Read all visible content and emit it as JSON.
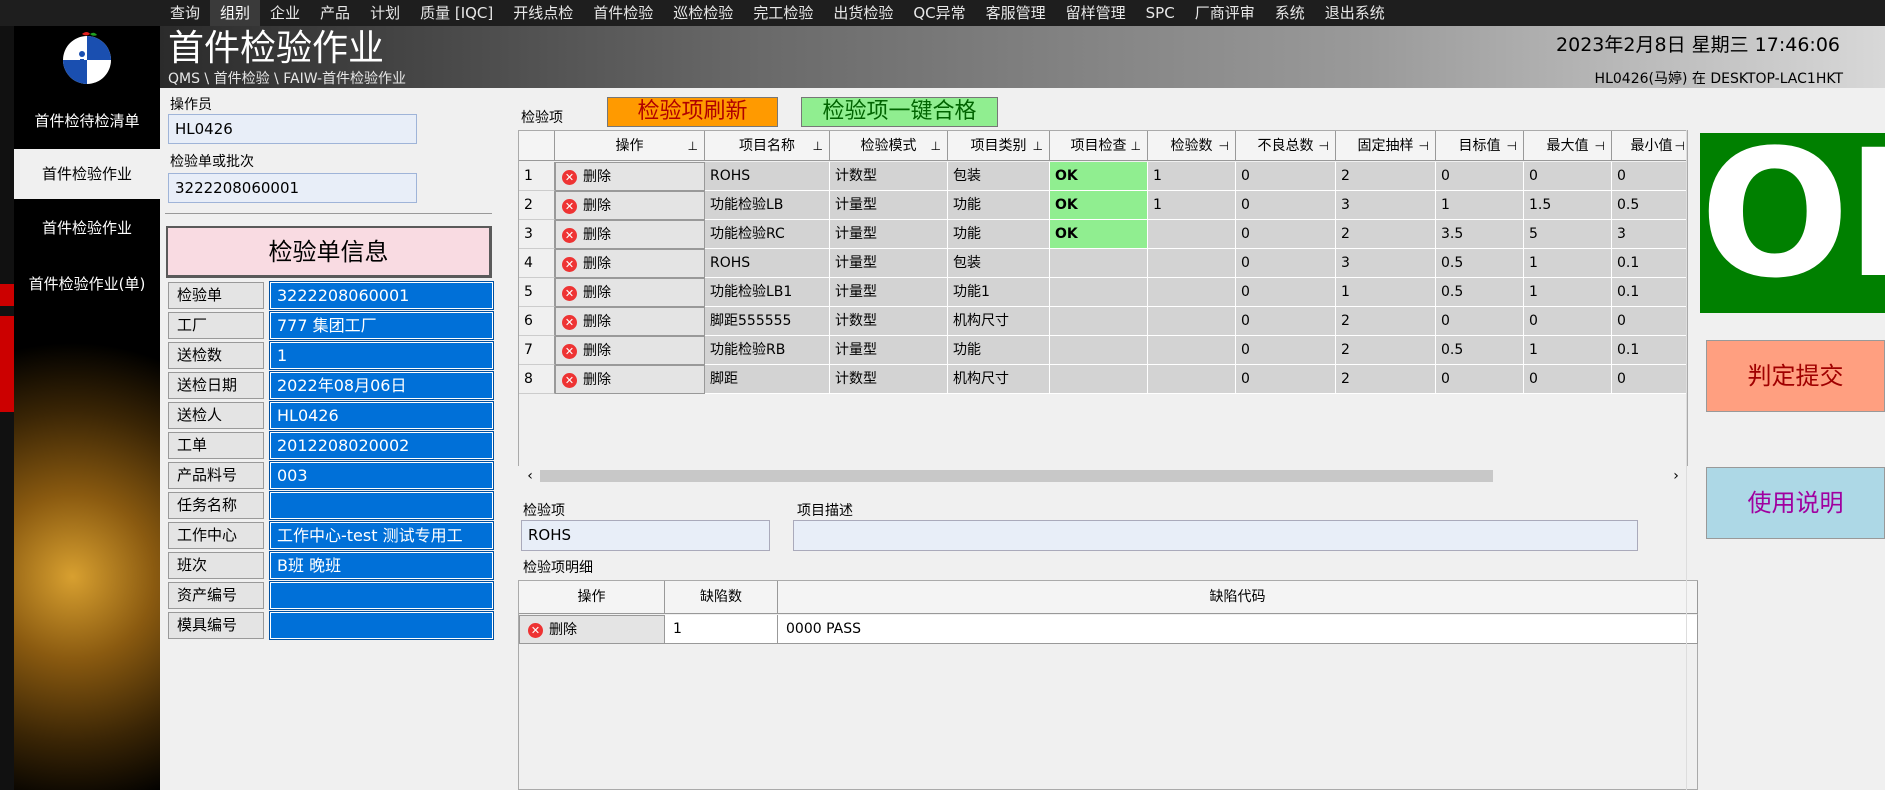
{
  "menu": {
    "hidden_item": "",
    "items": [
      "查询",
      "组别",
      "企业",
      "产品",
      "计划",
      "质量 [IQC]",
      "开线点检",
      "首件检验",
      "巡检检验",
      "完工检验",
      "出货检验",
      "QC异常",
      "客服管理",
      "留样管理",
      "SPC",
      "厂商评审",
      "系统",
      "退出系统"
    ],
    "active_index": 1
  },
  "header": {
    "title": "首件检验作业",
    "breadcrumb": "QMS \\ 首件检验 \\ FAIW-首件检验作业",
    "datetime": "2023年2月8日 星期三 17:46:06",
    "user": "HL0426(马婷) 在 DESKTOP-LAC1HKT"
  },
  "sidebar": {
    "items": [
      "首件检待检清单",
      "首件检验作业",
      "首件检验作业",
      "首件检验作业(单)"
    ],
    "active_index": 1
  },
  "form": {
    "operator_label": "操作员",
    "operator_value": "HL0426",
    "order_label": "检验单或批次",
    "order_value": "3222208060001"
  },
  "info": {
    "title": "检验单信息",
    "rows": [
      {
        "key": "检验单",
        "value": "3222208060001"
      },
      {
        "key": "工厂",
        "value": "777 集团工厂"
      },
      {
        "key": "送检数",
        "value": "1"
      },
      {
        "key": "送检日期",
        "value": "2022年08月06日"
      },
      {
        "key": "送检人",
        "value": "HL0426"
      },
      {
        "key": "工单",
        "value": "2012208020002"
      },
      {
        "key": "产品料号",
        "value": "003"
      },
      {
        "key": "任务名称",
        "value": ""
      },
      {
        "key": "工作中心",
        "value": "工作中心-test 测试专用工"
      },
      {
        "key": "班次",
        "value": "B班 晚班"
      },
      {
        "key": "资产编号",
        "value": ""
      },
      {
        "key": "模具编号",
        "value": ""
      }
    ]
  },
  "items_section": {
    "label": "检验项",
    "refresh_btn": "检验项刷新",
    "pass_all_btn": "检验项一键合格",
    "columns": [
      "操作",
      "项目名称",
      "检验模式",
      "项目类别",
      "项目检查",
      "检验数",
      "不良总数",
      "固定抽样",
      "目标值",
      "最大值",
      "最小值"
    ],
    "delete_label": "删除",
    "rows": [
      {
        "idx": "1",
        "name": "ROHS",
        "mode": "计数型",
        "cat": "包装",
        "check": "OK",
        "count": "1",
        "bad": "0",
        "sample": "2",
        "target": "0",
        "max": "0",
        "min": "0"
      },
      {
        "idx": "2",
        "name": "功能检验LB",
        "mode": "计量型",
        "cat": "功能",
        "check": "OK",
        "count": "1",
        "bad": "0",
        "sample": "3",
        "target": "1",
        "max": "1.5",
        "min": "0.5"
      },
      {
        "idx": "3",
        "name": "功能检验RC",
        "mode": "计量型",
        "cat": "功能",
        "check": "OK",
        "count": "",
        "bad": "0",
        "sample": "2",
        "target": "3.5",
        "max": "5",
        "min": "3"
      },
      {
        "idx": "4",
        "name": "ROHS",
        "mode": "计量型",
        "cat": "包装",
        "check": "",
        "count": "",
        "bad": "0",
        "sample": "3",
        "target": "0.5",
        "max": "1",
        "min": "0.1"
      },
      {
        "idx": "5",
        "name": "功能检验LB1",
        "mode": "计量型",
        "cat": "功能1",
        "check": "",
        "count": "",
        "bad": "0",
        "sample": "1",
        "target": "0.5",
        "max": "1",
        "min": "0.1"
      },
      {
        "idx": "6",
        "name": "脚距555555",
        "mode": "计数型",
        "cat": "机构尺寸",
        "check": "",
        "count": "",
        "bad": "0",
        "sample": "2",
        "target": "0",
        "max": "0",
        "min": "0"
      },
      {
        "idx": "7",
        "name": "功能检验RB",
        "mode": "计量型",
        "cat": "功能",
        "check": "",
        "count": "",
        "bad": "0",
        "sample": "2",
        "target": "0.5",
        "max": "1",
        "min": "0.1"
      },
      {
        "idx": "8",
        "name": "脚距",
        "mode": "计数型",
        "cat": "机构尺寸",
        "check": "",
        "count": "",
        "bad": "0",
        "sample": "2",
        "target": "0",
        "max": "0",
        "min": "0"
      }
    ]
  },
  "detail": {
    "item_label": "检验项",
    "item_value": "ROHS",
    "desc_label": "项目描述",
    "desc_value": "",
    "detail_label": "检验项明细",
    "columns": [
      "操作",
      "缺陷数",
      "缺陷代码"
    ],
    "row": {
      "action": "删除",
      "count": "1",
      "code": "0000 PASS"
    }
  },
  "right": {
    "status": "OK",
    "submit_btn": "判定提交",
    "help_btn": "使用说明"
  },
  "colors": {
    "ok_green": "#008000",
    "check_ok": "#90ee90",
    "info_blue": "#0070d8"
  }
}
